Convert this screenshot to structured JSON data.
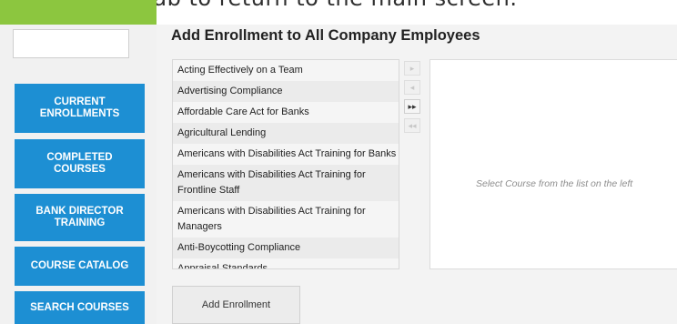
{
  "header_text": "ministration tab to return to the main screen.",
  "sidebar": {
    "buttons": [
      {
        "label": "CURRENT ENROLLMENTS"
      },
      {
        "label": "COMPLETED COURSES"
      },
      {
        "label": "BANK DIRECTOR TRAINING"
      },
      {
        "label": "COURSE CATALOG"
      },
      {
        "label": "SEARCH COURSES"
      }
    ]
  },
  "main": {
    "title": "Add Enrollment to All Company Employees",
    "courses": [
      "Acting Effectively on a Team",
      "Advertising Compliance",
      "Affordable Care Act for Banks",
      "Agricultural Lending",
      "Americans with Disabilities Act Training for Banks",
      "Americans with Disabilities Act Training for Frontline Staff",
      "Americans with Disabilities Act Training for Managers",
      "Anti-Boycotting Compliance",
      "Appraisal Standards"
    ],
    "move_buttons": [
      {
        "symbol": "▸",
        "name": "move-right-icon"
      },
      {
        "symbol": "◂",
        "name": "move-left-icon"
      },
      {
        "symbol": "▸▸",
        "name": "move-all-right-icon"
      },
      {
        "symbol": "◂◂",
        "name": "move-all-left-icon"
      }
    ],
    "selected_placeholder": "Select Course from the list on the left",
    "add_button_label": "Add Enrollment"
  },
  "colors": {
    "accent_blue": "#1d8fd3",
    "accent_green": "#8cc63f"
  }
}
